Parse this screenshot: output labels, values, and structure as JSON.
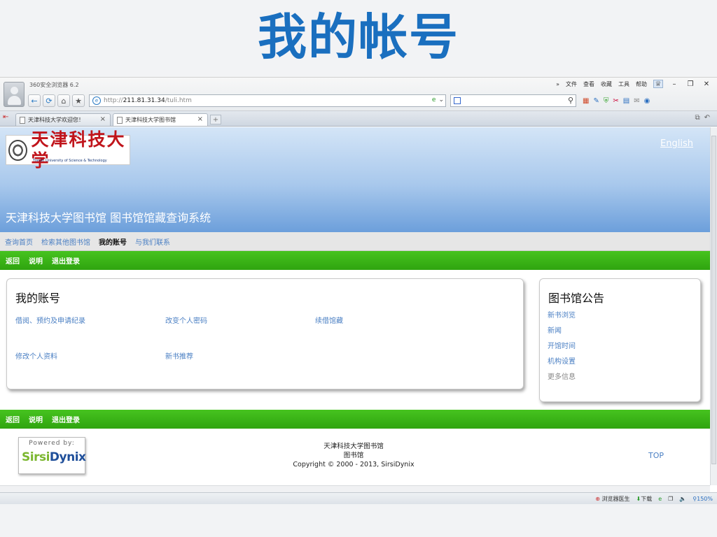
{
  "slide": {
    "title": "我的帐号"
  },
  "browser": {
    "name": "360安全浏览器 6.2",
    "menu": [
      "»",
      "文件",
      "查看",
      "收藏",
      "工具",
      "帮助"
    ],
    "address": {
      "scheme": "http://",
      "host": "211.81.31.34",
      "path": "/tuli.htm"
    },
    "search_value": "",
    "tabs": [
      {
        "label": "天津科技大学欢迎您！",
        "active": false
      },
      {
        "label": "天津科技大学图书馆",
        "active": true
      }
    ],
    "status": {
      "doctor": "浏览器医生",
      "download": "下载",
      "zoom": "150%"
    }
  },
  "site": {
    "logo_text": "天津科技大学",
    "logo_sub": "Tianjin University of Science & Technology",
    "english_link": "English",
    "title": "天津科技大学图书馆  图书馆馆藏查询系统",
    "topnav": [
      {
        "label": "查询首页",
        "current": false
      },
      {
        "label": "检索其他图书馆",
        "current": false
      },
      {
        "label": "我的账号",
        "current": true
      },
      {
        "label": "与我们联系",
        "current": false
      }
    ],
    "action_bar": [
      "返回",
      "说明",
      "退出登录"
    ],
    "account": {
      "heading": "我的账号",
      "links": [
        "借阅、预约及申请纪录",
        "改变个人密码",
        "续借馆藏",
        "修改个人资料",
        "新书推荐"
      ]
    },
    "notice": {
      "heading": "图书馆公告",
      "links": [
        "新书浏览",
        "新闻",
        "开馆时间",
        "机构设置",
        "更多信息"
      ]
    },
    "footer": {
      "powered_by": "Powered by:",
      "brand_a": "Sirsi",
      "brand_b": "Dynix",
      "line1": "天津科技大学图书馆",
      "line2": "图书馆",
      "copyright": "Copyright © 2000 - 2013, SirsiDynix",
      "top": "TOP"
    }
  }
}
